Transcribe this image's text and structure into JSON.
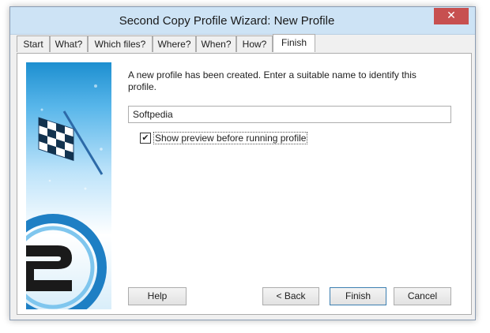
{
  "window": {
    "title": "Second Copy Profile Wizard: New Profile",
    "close_glyph": "✕"
  },
  "tabs": [
    {
      "label": "Start"
    },
    {
      "label": "What?"
    },
    {
      "label": "Which files?"
    },
    {
      "label": "Where?"
    },
    {
      "label": "When?"
    },
    {
      "label": "How?"
    },
    {
      "label": "Finish"
    }
  ],
  "active_tab": "Finish",
  "finish_page": {
    "intro_text": "A new profile has been created. Enter a suitable name to identify this profile.",
    "profile_name": "Softpedia",
    "preview_checkbox": {
      "label": "Show preview before running profile",
      "checked": true,
      "glyph": "✔"
    }
  },
  "buttons": {
    "help": "Help",
    "back": "< Back",
    "finish": "Finish",
    "cancel": "Cancel"
  },
  "colors": {
    "titlebar": "#cde3f5",
    "close_button": "#c75050",
    "banner_blue": "#1d8fd0",
    "default_button_border": "#3c7fb1"
  }
}
